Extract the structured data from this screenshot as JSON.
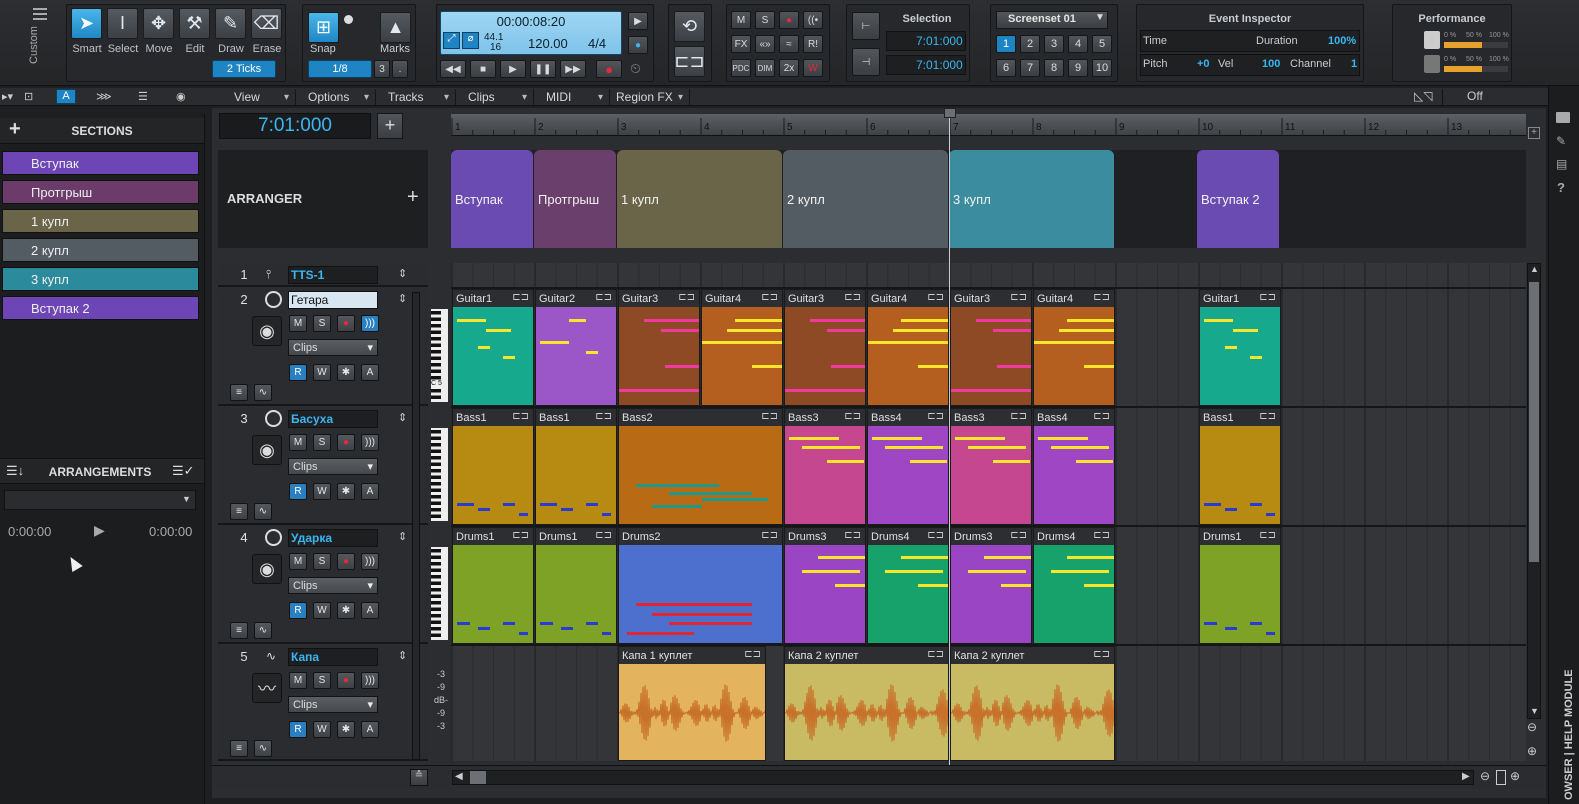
{
  "control_bar": {
    "custom_label": "Custom",
    "tools": [
      {
        "label": "Smart",
        "icon": "arrow-cursor-icon",
        "active": true
      },
      {
        "label": "Select",
        "icon": "i-beam-icon",
        "active": false
      },
      {
        "label": "Move",
        "icon": "move-cross-icon",
        "active": false
      },
      {
        "label": "Edit",
        "icon": "wrench-icon",
        "active": false
      },
      {
        "label": "Draw",
        "icon": "pencil-icon",
        "active": false
      },
      {
        "label": "Erase",
        "icon": "eraser-icon",
        "active": false
      }
    ],
    "snap_label": "Snap",
    "marks_label": "Marks",
    "ticks": "2 Ticks",
    "snap_value": "1/8",
    "snap_triplet": "3",
    "transport": {
      "time": "00:00:08:20",
      "sample_rate_top": "44.1",
      "sample_rate_bottom": "16",
      "tempo": "120.00",
      "meter": "4/4"
    },
    "mix_buttons": [
      "M",
      "S",
      "●",
      "((•",
      "FX",
      "«»",
      "≈",
      "R!",
      "PDC",
      "DIM",
      "2x",
      "W"
    ],
    "selection_title": "Selection",
    "selection_start": "7:01:000",
    "selection_end": "7:01:000",
    "screenset_title": "Screenset 01",
    "screensets": [
      "1",
      "2",
      "3",
      "4",
      "5",
      "6",
      "7",
      "8",
      "9",
      "10"
    ],
    "event_inspector": {
      "title": "Event Inspector",
      "time_label": "Time",
      "duration_label": "Duration",
      "duration_value": "100%",
      "pitch_label": "Pitch",
      "pitch_value": "+0",
      "vel_label": "Vel",
      "vel_value": "100",
      "channel_label": "Channel",
      "channel_value": "1"
    },
    "performance_title": "Performance",
    "meter_scale": [
      "0 %",
      "50 %",
      "100 %"
    ]
  },
  "menu_bar": {
    "items": [
      "View",
      "Options",
      "Tracks",
      "Clips",
      "MIDI",
      "Region FX"
    ],
    "off_label": "Off"
  },
  "sections_panel": {
    "title": "SECTIONS",
    "add": "+",
    "items": [
      {
        "label": "Вступак",
        "color": "#6e45b4"
      },
      {
        "label": "Протгрыш",
        "color": "#6b3c6a"
      },
      {
        "label": "1 купл",
        "color": "#6a6549"
      },
      {
        "label": "2 купл",
        "color": "#535b63"
      },
      {
        "label": "3 купл",
        "color": "#2b8a9c"
      },
      {
        "label": "Вступак 2",
        "color": "#6e45b4"
      }
    ],
    "arrangements_title": "ARRANGEMENTS",
    "arr_time_start": "0:00:00",
    "arr_time_end": "0:00:00"
  },
  "now_time": "7:01:000",
  "arranger": {
    "label": "ARRANGER",
    "add": "+",
    "sections": [
      {
        "label": "Вступак",
        "color": "#6a4bb2"
      },
      {
        "label": "Протгрыш",
        "color": "#6a3f6b"
      },
      {
        "label": "1 купл",
        "color": "#6a6548"
      },
      {
        "label": "2 купл",
        "color": "#535b63"
      },
      {
        "label": "3 купл",
        "color": "#3a8c9e"
      },
      {
        "label": "Вступак 2",
        "color": "#6a4bb2"
      }
    ]
  },
  "ruler": [
    "1",
    "2",
    "3",
    "4",
    "5",
    "6",
    "7",
    "8",
    "9",
    "10",
    "11",
    "12",
    "13"
  ],
  "tracks": [
    {
      "num": "1",
      "name": "TTS-1"
    },
    {
      "num": "2",
      "name": "Гетара",
      "mode": "Clips"
    },
    {
      "num": "3",
      "name": "Басуха",
      "mode": "Clips"
    },
    {
      "num": "4",
      "name": "Ударка",
      "mode": "Clips"
    },
    {
      "num": "5",
      "name": "Капа",
      "mode": "Clips"
    }
  ],
  "track_buttons": {
    "m": "M",
    "s": "S",
    "r": "R",
    "w": "W",
    "a": "A"
  },
  "piano_label": "C 5",
  "db_scale": [
    "-3",
    "-9",
    "dB-",
    "-9",
    "-3"
  ],
  "clips": {
    "guitar": [
      "Guitar1",
      "Guitar2",
      "Guitar3",
      "Guitar4",
      "Guitar3",
      "Guitar4",
      "Guitar3",
      "Guitar4",
      "Guitar1"
    ],
    "bass": [
      "Bass1",
      "Bass1",
      "Bass2",
      "Bass3",
      "Bass4",
      "Bass3",
      "Bass4",
      "Bass1"
    ],
    "drums": [
      "Drums1",
      "Drums1",
      "Drums2",
      "Drums3",
      "Drums4",
      "Drums3",
      "Drums4",
      "Drums1"
    ],
    "vocal": [
      "Капа 1 куплет",
      "Капа 2 куплет",
      "Капа 2 куплет"
    ]
  },
  "side_tab": "OWSER | HELP MODULE"
}
